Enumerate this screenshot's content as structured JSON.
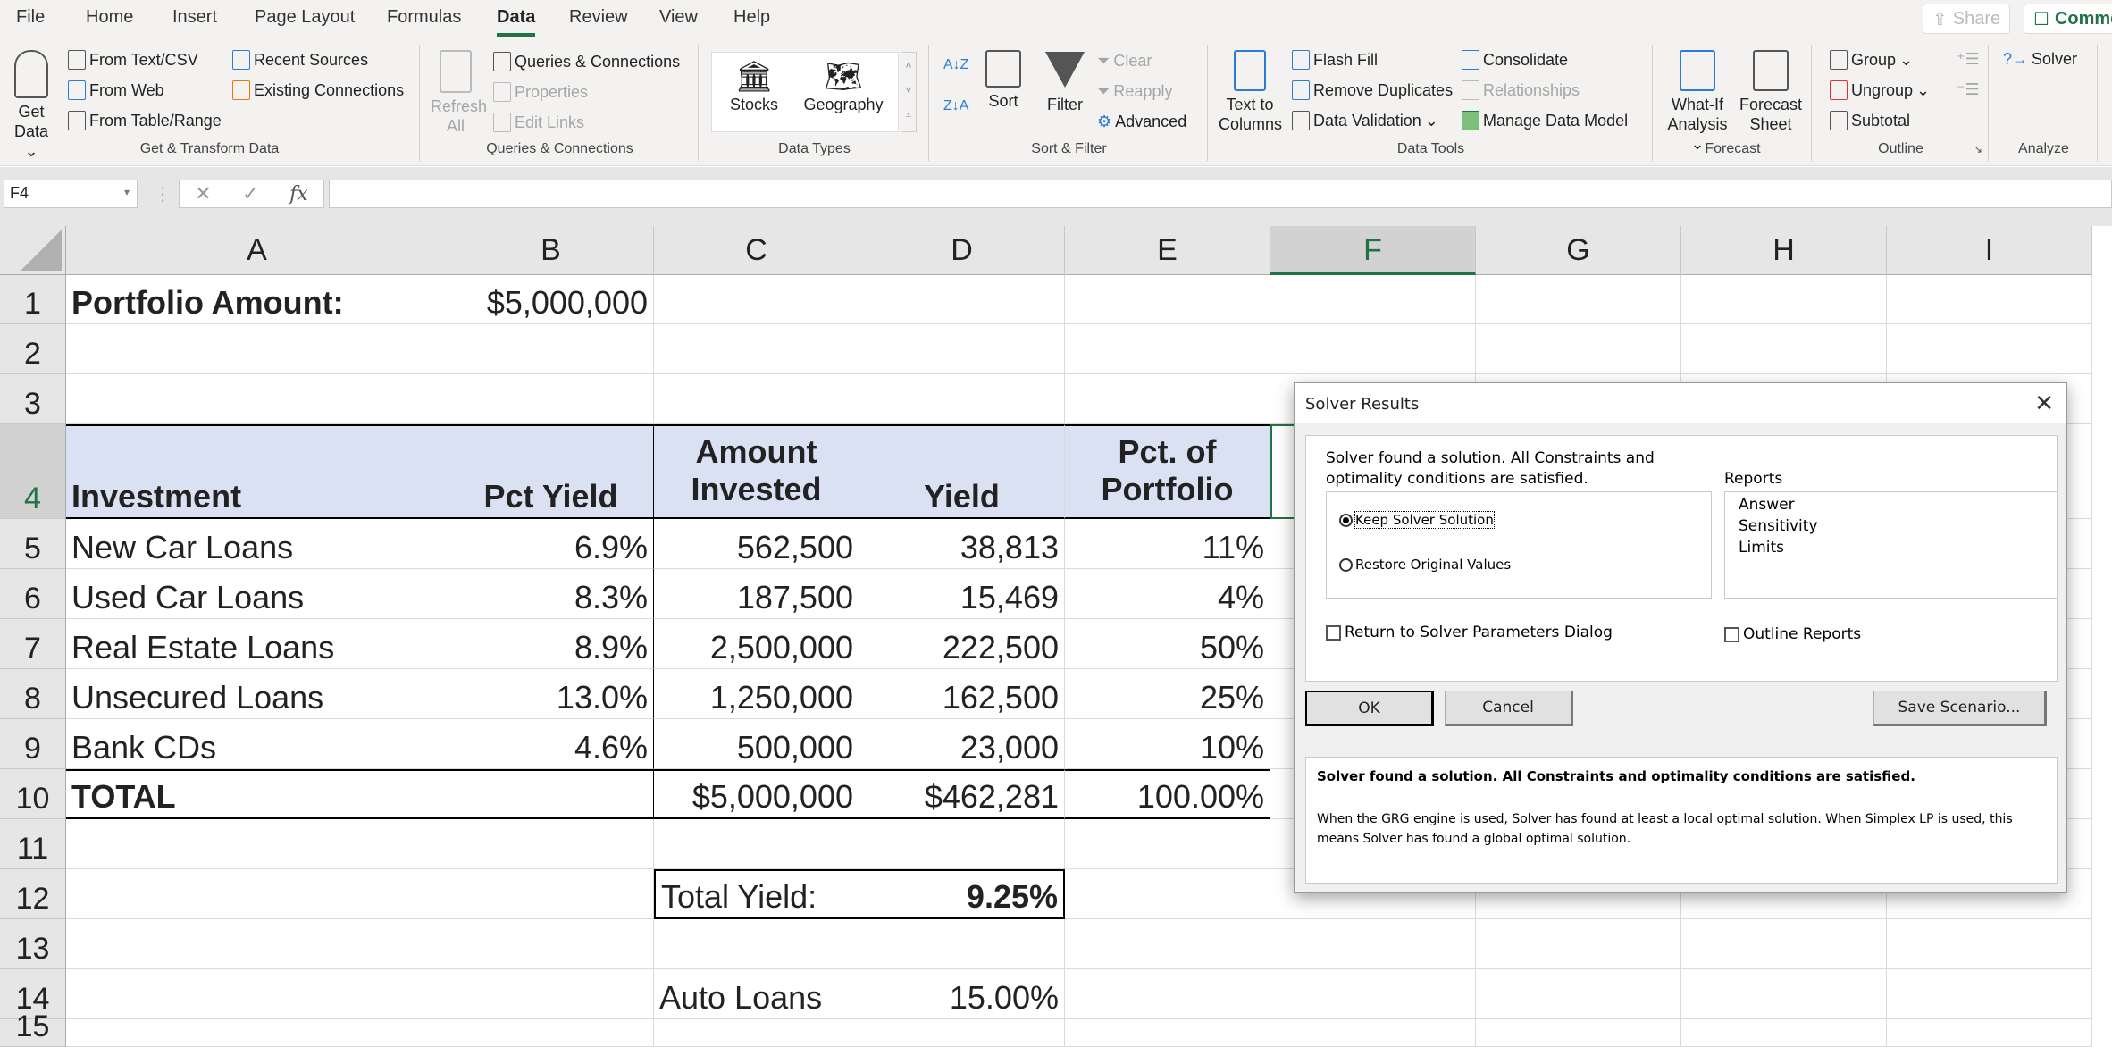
{
  "tabs": [
    "File",
    "Home",
    "Insert",
    "Page Layout",
    "Formulas",
    "Data",
    "Review",
    "View",
    "Help"
  ],
  "active_tab": "Data",
  "top_buttons": {
    "share": "Share",
    "comments": "Comments"
  },
  "ribbon": {
    "get_transform": {
      "label": "Get & Transform Data",
      "get_data": "Get Data",
      "from_text_csv": "From Text/CSV",
      "from_web": "From Web",
      "from_table_range": "From Table/Range",
      "recent_sources": "Recent Sources",
      "existing_connections": "Existing Connections"
    },
    "queries": {
      "label": "Queries & Connections",
      "refresh_all": "Refresh All",
      "queries_connections": "Queries & Connections",
      "properties": "Properties",
      "edit_links": "Edit Links"
    },
    "data_types": {
      "label": "Data Types",
      "stocks": "Stocks",
      "geography": "Geography"
    },
    "sort_filter": {
      "label": "Sort & Filter",
      "sort": "Sort",
      "filter": "Filter",
      "clear": "Clear",
      "reapply": "Reapply",
      "advanced": "Advanced"
    },
    "data_tools": {
      "label": "Data Tools",
      "text_to_columns": "Text to Columns",
      "flash_fill": "Flash Fill",
      "remove_duplicates": "Remove Duplicates",
      "data_validation": "Data Validation",
      "consolidate": "Consolidate",
      "relationships": "Relationships",
      "manage_data_model": "Manage Data Model"
    },
    "forecast": {
      "label": "Forecast",
      "what_if": "What-If Analysis",
      "forecast_sheet": "Forecast Sheet"
    },
    "outline": {
      "label": "Outline",
      "group": "Group",
      "ungroup": "Ungroup",
      "subtotal": "Subtotal"
    },
    "analyze": {
      "label": "Analyze",
      "solver": "Solver"
    }
  },
  "formula_bar": {
    "name_box": "F4",
    "formula": ""
  },
  "columns": [
    "A",
    "B",
    "C",
    "D",
    "E",
    "F",
    "G",
    "H",
    "I"
  ],
  "selected_column": "F",
  "rows": [
    "1",
    "2",
    "3",
    "4",
    "5",
    "6",
    "7",
    "8",
    "9",
    "10",
    "11",
    "12",
    "13",
    "14",
    "15"
  ],
  "selected_row": "4",
  "sheet": {
    "portfolio_label": "Portfolio Amount:",
    "portfolio_amount": "$5,000,000",
    "headers": {
      "investment": "Investment",
      "pct_yield": "Pct Yield",
      "amount_line1": "Amount",
      "amount_line2": "Invested",
      "yield": "Yield",
      "pct_portfolio_line1": "Pct. of",
      "pct_portfolio_line2": "Portfolio"
    },
    "investments": [
      {
        "name": "New Car Loans",
        "pct_yield": "6.9%",
        "amount": "562,500",
        "yield": "38,813",
        "pct": "11%"
      },
      {
        "name": "Used Car Loans",
        "pct_yield": "8.3%",
        "amount": "187,500",
        "yield": "15,469",
        "pct": "4%"
      },
      {
        "name": "Real Estate Loans",
        "pct_yield": "8.9%",
        "amount": "2,500,000",
        "yield": "222,500",
        "pct": "50%"
      },
      {
        "name": "Unsecured Loans",
        "pct_yield": "13.0%",
        "amount": "1,250,000",
        "yield": "162,500",
        "pct": "25%"
      },
      {
        "name": "Bank CDs",
        "pct_yield": "4.6%",
        "amount": "500,000",
        "yield": "23,000",
        "pct": "10%"
      }
    ],
    "total": {
      "label": "TOTAL",
      "amount": "$5,000,000",
      "yield": "$462,281",
      "pct": "100.00%"
    },
    "total_yield_label": "Total Yield:",
    "total_yield_value": "9.25%",
    "auto_loans_label": "Auto Loans",
    "auto_loans_value": "15.00%"
  },
  "dialog": {
    "title": "Solver Results",
    "message_line1": "Solver found a solution.  All Constraints and",
    "message_line2": "optimality conditions are satisfied.",
    "keep_solution": "Keep Solver Solution",
    "restore_values": "Restore Original Values",
    "reports_label": "Reports",
    "reports": [
      "Answer",
      "Sensitivity",
      "Limits"
    ],
    "return_dialog": "Return to Solver Parameters Dialog",
    "outline_reports": "Outline Reports",
    "ok": "OK",
    "cancel": "Cancel",
    "save_scenario": "Save Scenario...",
    "detail_bold": "Solver found a solution.  All Constraints and optimality conditions are satisfied.",
    "detail_text": "When the GRG engine is used, Solver has found at least a local optimal solution. When Simplex LP is used, this means Solver has found a global optimal solution."
  }
}
